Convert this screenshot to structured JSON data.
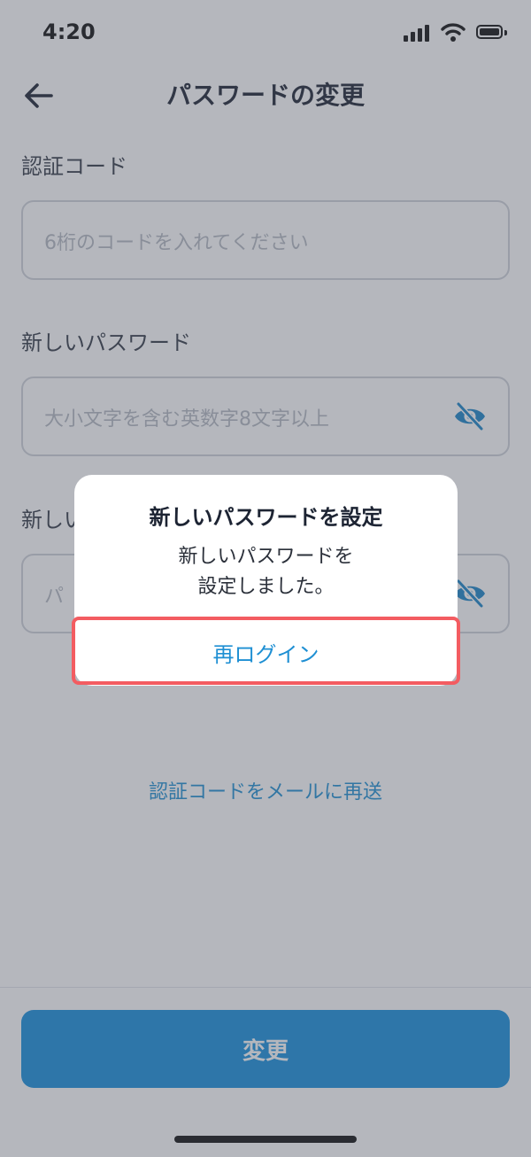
{
  "status_bar": {
    "time": "4:20"
  },
  "header": {
    "title": "パスワードの変更"
  },
  "form": {
    "code": {
      "label": "認証コード",
      "placeholder": "6桁のコードを入れてください"
    },
    "new_password": {
      "label": "新しいパスワード",
      "placeholder": "大小文字を含む英数字8文字以上"
    },
    "confirm_password": {
      "label": "新しい",
      "placeholder": "パ"
    }
  },
  "resend_link": "認証コードをメールに再送",
  "submit_label": "変更",
  "dialog": {
    "title": "新しいパスワードを設定",
    "message": "新しいパスワードを\n設定しました。",
    "button": "再ログイン"
  },
  "colors": {
    "accent": "#1e8fd3",
    "primary_button": "#178fdc",
    "highlight": "#f35c61",
    "eye_icon": "#1a86c8"
  },
  "icons": {
    "back": "arrow-left-icon",
    "password_visibility": "eye-off-icon"
  }
}
